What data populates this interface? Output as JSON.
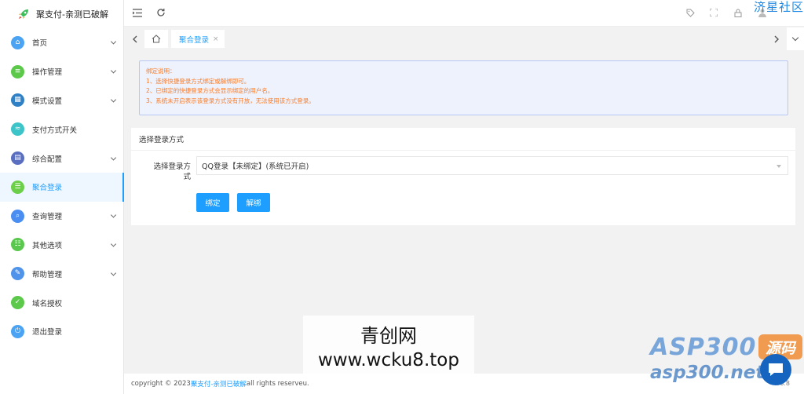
{
  "brand": {
    "title": "聚支付-亲测已破解"
  },
  "sidebar": {
    "items": [
      {
        "label": "首页",
        "icon": "house-icon",
        "color": "#4ba3f3",
        "has_children": true,
        "glyph": "⌂"
      },
      {
        "label": "操作管理",
        "icon": "list-icon",
        "color": "#5cc94a",
        "has_children": true,
        "glyph": "≡"
      },
      {
        "label": "模式设置",
        "icon": "chart-icon",
        "color": "#2f80c4",
        "has_children": true,
        "glyph": "▦"
      },
      {
        "label": "支付方式开关",
        "icon": "switch-icon",
        "color": "#3cc4c8",
        "has_children": false,
        "glyph": "≈"
      },
      {
        "label": "综合配置",
        "icon": "book-icon",
        "color": "#5a6fbf",
        "has_children": true,
        "glyph": "▤"
      },
      {
        "label": "聚合登录",
        "icon": "login-icon",
        "color": "#6ccf4a",
        "has_children": false,
        "glyph": "☰",
        "active": true
      },
      {
        "label": "查询管理",
        "icon": "search-icon",
        "color": "#4a8ef2",
        "has_children": true,
        "glyph": "⌕"
      },
      {
        "label": "其他选项",
        "icon": "options-icon",
        "color": "#5ac84e",
        "has_children": true,
        "glyph": "☷"
      },
      {
        "label": "帮助管理",
        "icon": "help-icon",
        "color": "#4f94ea",
        "has_children": true,
        "glyph": "✎"
      },
      {
        "label": "域名授权",
        "icon": "shield-icon",
        "color": "#5cc94a",
        "has_children": false,
        "glyph": "✓"
      },
      {
        "label": "退出登录",
        "icon": "power-icon",
        "color": "#4ba3f3",
        "has_children": false,
        "glyph": "⏻"
      }
    ]
  },
  "topbar": {
    "watermark": "济星社区"
  },
  "tabs": {
    "current": "聚合登录",
    "close": "×"
  },
  "notice": {
    "lines": [
      "绑定说明：",
      "1、选择快捷登录方式绑定或解绑即可。",
      "2、已绑定的快捷登录方式会显示绑定的用户名。",
      "3、系统未开启表示该登录方式没有开放，无法使用该方式登录。"
    ]
  },
  "card": {
    "title": "选择登录方式",
    "form_label": "选择登录方式",
    "select_value": "QQ登录【未绑定】(系统已开启)",
    "bind_label": "绑定",
    "unbind_label": "解绑"
  },
  "footer": {
    "prefix": "copyright © 2023 ",
    "link": "聚支付-亲测已破解",
    "suffix": " all rights reserveu.",
    "version": "v6.8"
  },
  "overlays": {
    "cn_site": "青创网",
    "url": "www.wcku8.top",
    "asp_logo": "ASP300",
    "asp_badge": "源码",
    "asp_url": "asp300.net"
  },
  "colors": {
    "accent": "#1e9fff",
    "notice_text": "#ff7a22"
  }
}
